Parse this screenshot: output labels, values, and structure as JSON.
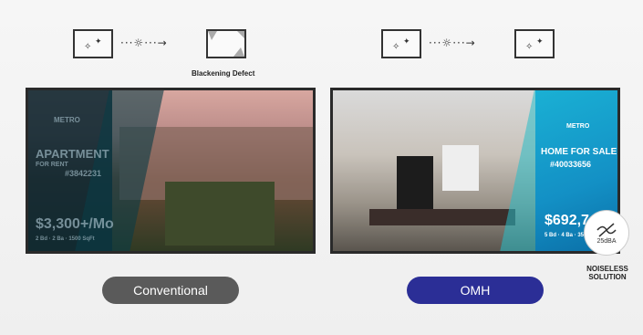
{
  "diagram_left": {
    "arrow": "···☼···→",
    "defect_label": "Blackening Defect"
  },
  "diagram_right": {
    "arrow": "···☼···→"
  },
  "screen_left": {
    "logo": "METRO",
    "heading": "APARTMENT",
    "sub": "FOR RENT",
    "id": "#3842231",
    "price": "$3,300+/Mo",
    "details": "2 Bd · 2 Ba · 1500 SqFt"
  },
  "screen_right": {
    "logo": "METRO",
    "heading": "HOME FOR SALE",
    "id": "#40033656",
    "price": "$692,7",
    "details": "5 Bd · 4 Ba · 35"
  },
  "labels": {
    "conventional": "Conventional",
    "omh": "OMH"
  },
  "noise": {
    "db": "25dBA",
    "title_line1": "NOISELESS",
    "title_line2": "SOLUTION"
  }
}
